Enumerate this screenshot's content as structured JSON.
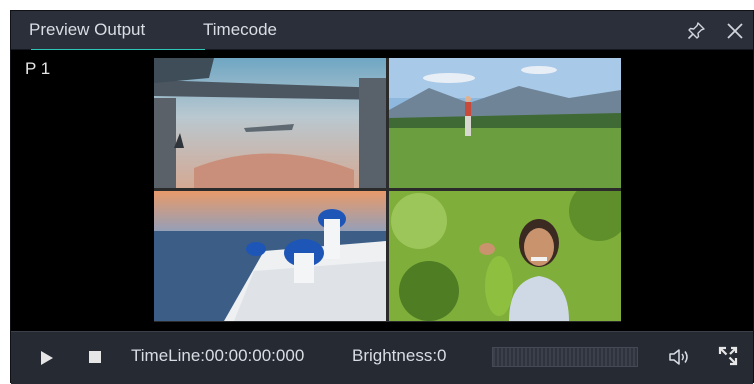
{
  "tabs": [
    {
      "label": "Preview Output",
      "active": true
    },
    {
      "label": "Timecode",
      "active": false
    }
  ],
  "titlebar_icons": [
    "pin-icon",
    "close-icon"
  ],
  "preview": {
    "program_label": "P 1",
    "thumbnails": [
      {
        "name": "fantasy-city-thumbnail"
      },
      {
        "name": "golfer-thumbnail"
      },
      {
        "name": "santorini-thumbnail"
      },
      {
        "name": "woman-grapes-thumbnail"
      }
    ]
  },
  "controls": {
    "icons": [
      "play-icon",
      "stop-icon",
      "volume-icon",
      "fullscreen-icon"
    ],
    "timeline_text": "TimeLine:00:00:00:000",
    "brightness_text": "Brightness:0",
    "brightness_value": 0
  },
  "colors": {
    "accent": "#2ec4b6",
    "window_bg": "#1f232c",
    "preview_bg": "#000000"
  }
}
